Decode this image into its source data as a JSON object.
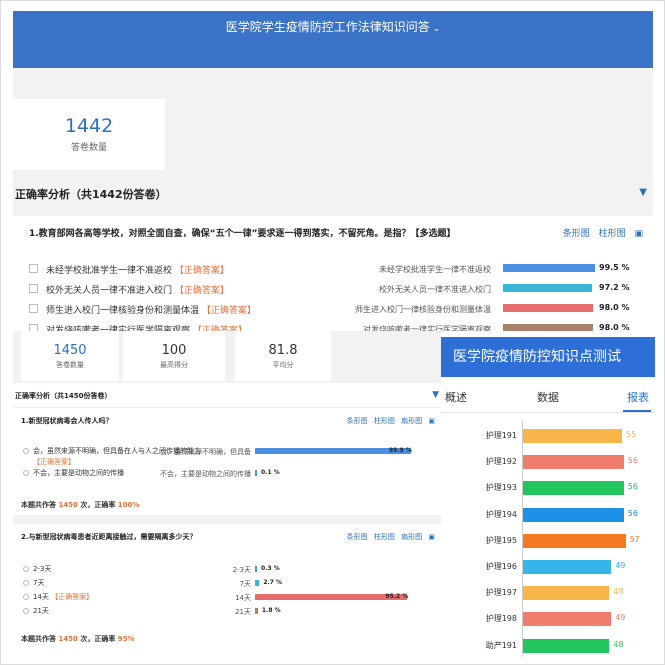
{
  "top": {
    "header_title": "医学院学生疫情防控工作法律知识问答",
    "answer_count": "1442",
    "answer_count_label": "答卷数量",
    "section_title": "正确率分析（共1442份答卷）",
    "question": "1.教育部网各高等学校，对照全面自查，确保“五个一律”要求逐一得到落实，不留死角。是指？【多选题】",
    "view_bar": "条形图",
    "view_column": "柱形图",
    "correct_tag": "【正确答案】",
    "options": [
      {
        "text": "未经学校批准学生一律不准返校",
        "label": "未经学校批准学生一律不准返校",
        "value": 99.5,
        "pct": "99.5 %",
        "color": "#4a8fe0"
      },
      {
        "text": "校外无关人员一律不准进入校门",
        "label": "校外无关人员一律不准进入校门",
        "value": 97.2,
        "pct": "97.2 %",
        "color": "#3ab5d6"
      },
      {
        "text": "师生进入校门一律核验身份和测量体温",
        "label": "师生进入校门一律核验身份和测量体温",
        "value": 98.0,
        "pct": "98.0 %",
        "color": "#e66d6d"
      },
      {
        "text": "对发烧咳嗽者一律实行医学隔离观察",
        "label": "对发烧咳嗽者一律实行医学隔离观察",
        "value": 98.0,
        "pct": "98.0 %",
        "color": "#a8826a"
      }
    ]
  },
  "bl": {
    "stats": [
      {
        "value": "1450",
        "label": "答卷数量"
      },
      {
        "value": "100",
        "label": "最高得分"
      },
      {
        "value": "81.8",
        "label": "平均分"
      }
    ],
    "section_title": "正确率分析（共1450份答卷）",
    "views": [
      "条形图",
      "柱形图",
      "扇形图"
    ],
    "correct_tag": "【正确答案】",
    "questions": [
      {
        "text": "1.新型冠状病毒会人传人吗？",
        "options": [
          {
            "text": "会，虽然来源不明确，但具备在人与人之间传播的能力",
            "label": "会，虽然来源不明确，但具备",
            "value": 99.9,
            "pct": "99.9 %",
            "correct": true
          },
          {
            "text": "不会，主要是动物之间的传播",
            "label": "不会，主要是动物之间的传播",
            "value": 0.1,
            "pct": "0.1 %",
            "correct": false
          }
        ],
        "summary": {
          "prefix": "本题共作答 ",
          "count": "1450",
          "middle": " 次，正确率 ",
          "rate": "100%"
        }
      },
      {
        "text": "2.与新型冠状病毒患者近距离接触过，需要隔离多少天？",
        "options": [
          {
            "text": "2-3天",
            "label": "2-3天",
            "value": 0.3,
            "pct": "0.3 %",
            "correct": false,
            "color": "#4a8fe0"
          },
          {
            "text": "7天",
            "label": "7天",
            "value": 2.7,
            "pct": "2.7 %",
            "correct": false,
            "color": "#3ab5d6"
          },
          {
            "text": "14天",
            "label": "14天",
            "value": 95.2,
            "pct": "95.2 %",
            "correct": true,
            "color": "#e66d6d"
          },
          {
            "text": "21天",
            "label": "21天",
            "value": 1.8,
            "pct": "1.8 %",
            "correct": false,
            "color": "#a8826a"
          }
        ],
        "summary": {
          "prefix": "本题共作答 ",
          "count": "1450",
          "middle": " 次，正确率 ",
          "rate": "95%"
        }
      }
    ]
  },
  "br": {
    "header_title": "医学院疫情防控知识点测试",
    "tabs": [
      "概述",
      "数据",
      "报表"
    ],
    "chart_data": {
      "type": "bar",
      "categories": [
        "护理191",
        "护理192",
        "护理193",
        "护理194",
        "护理195",
        "护理196",
        "护理197",
        "护理198",
        "助产191"
      ],
      "values": [
        55,
        56,
        56,
        56,
        57,
        49,
        48,
        49,
        48
      ],
      "colors": [
        "#f7b54a",
        "#f07d6b",
        "#22c55e",
        "#1e90e8",
        "#f47a22",
        "#36b6e8",
        "#f7b54a",
        "#f07d6b",
        "#22c55e"
      ]
    }
  }
}
